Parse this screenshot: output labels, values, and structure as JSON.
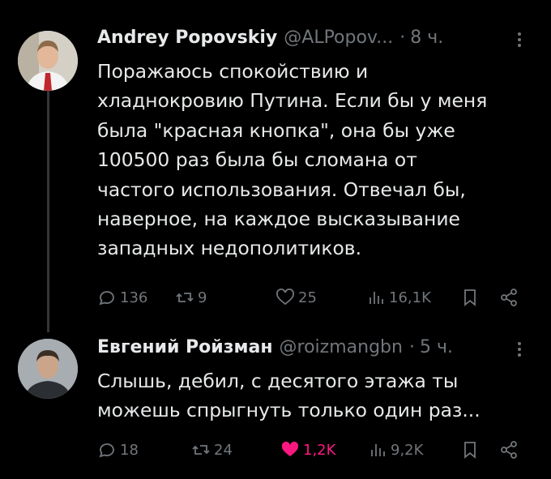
{
  "tweets": [
    {
      "author": "Andrey Popovskiy",
      "handle": "@ALPopov...",
      "separator": "·",
      "time": "8 ч.",
      "lines": [
        "Поражаюсь спокойствию и",
        "хладнокровию Путина. Если бы у меня",
        "была \"красная кнопка\", она бы уже",
        "100500 раз была бы сломана от",
        "частого использования. Отвечал бы,",
        "наверное, на каждое высказывание",
        "западных недополитиков."
      ],
      "replies": "136",
      "retweets": "9",
      "likes": "25",
      "views": "16,1K",
      "liked": false
    },
    {
      "author": "Евгений Ройзман",
      "handle": "@roizmangbn",
      "separator": "·",
      "time": "5 ч.",
      "lines": [
        "Слышь, дебил, с десятого этажа ты",
        "можешь спрыгнуть только один раз..."
      ],
      "replies": "18",
      "retweets": "24",
      "likes": "1,2K",
      "views": "9,2K",
      "liked": true
    }
  ],
  "colors": {
    "background": "#000000",
    "text": "#e7e9ea",
    "muted": "#71767b",
    "like": "#f91880",
    "thread": "#333639"
  },
  "icons": [
    "reply-icon",
    "retweet-icon",
    "like-icon",
    "views-icon",
    "bookmark-icon",
    "share-icon",
    "more-icon"
  ]
}
